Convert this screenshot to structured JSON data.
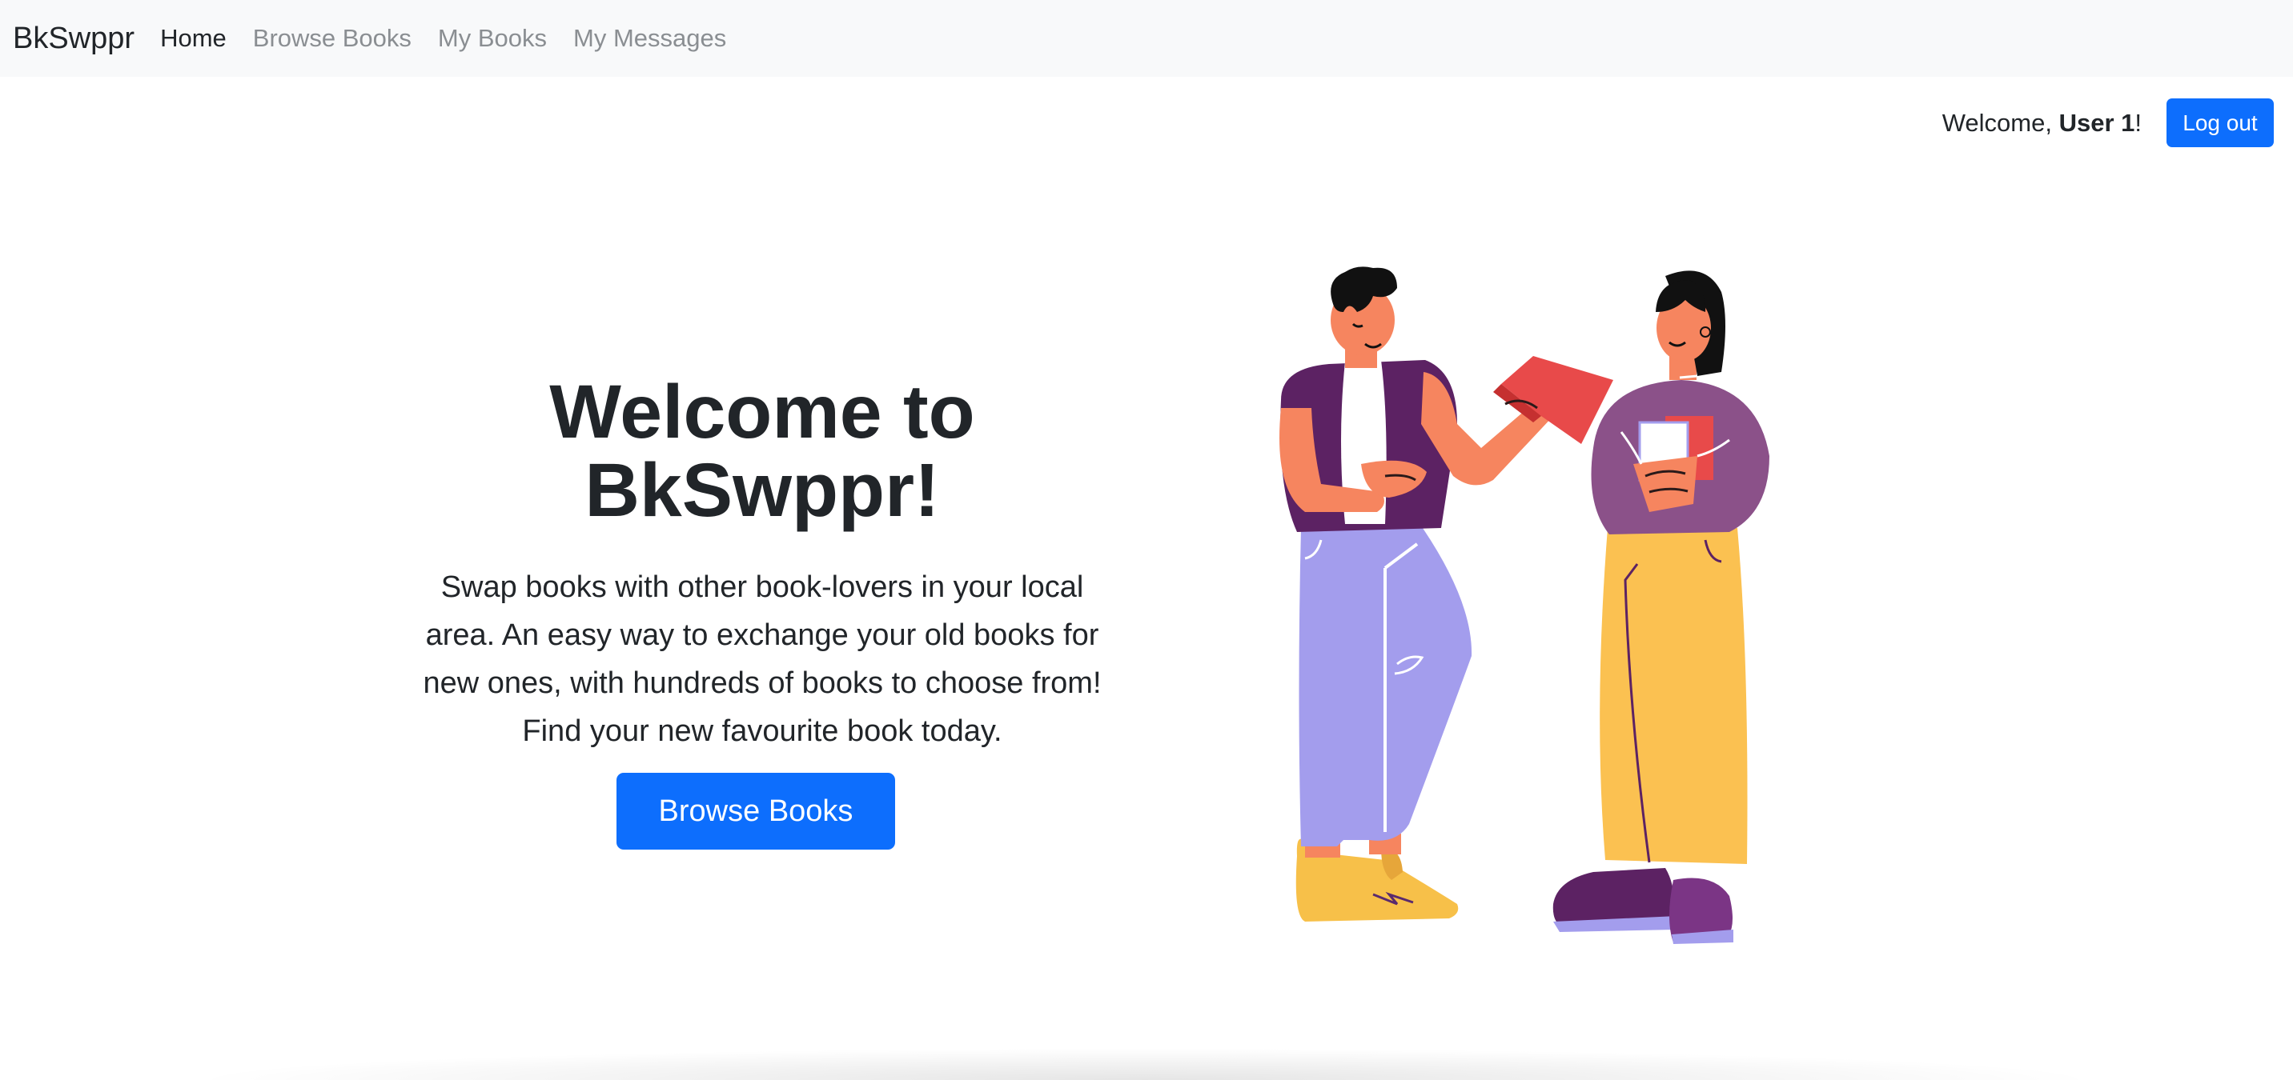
{
  "navbar": {
    "brand": "BkSwppr",
    "links": [
      {
        "label": "Home",
        "active": true
      },
      {
        "label": "Browse Books",
        "active": false
      },
      {
        "label": "My Books",
        "active": false
      },
      {
        "label": "My Messages",
        "active": false
      }
    ]
  },
  "user_bar": {
    "welcome_prefix": "Welcome, ",
    "username": "User 1",
    "welcome_suffix": "!",
    "logout_label": "Log out"
  },
  "hero": {
    "title": "Welcome to BkSwppr!",
    "description": "Swap books with other book-lovers in your local area. An easy way to exchange your old books for new ones, with hundreds of books to choose from! Find your new favourite book today.",
    "cta_label": "Browse Books",
    "illustration": "people-swapping-books-illustration"
  },
  "colors": {
    "primary": "#0d6efd",
    "navbar_bg": "#f8f9fa",
    "text": "#212529",
    "muted_link": "#8a8e92"
  }
}
